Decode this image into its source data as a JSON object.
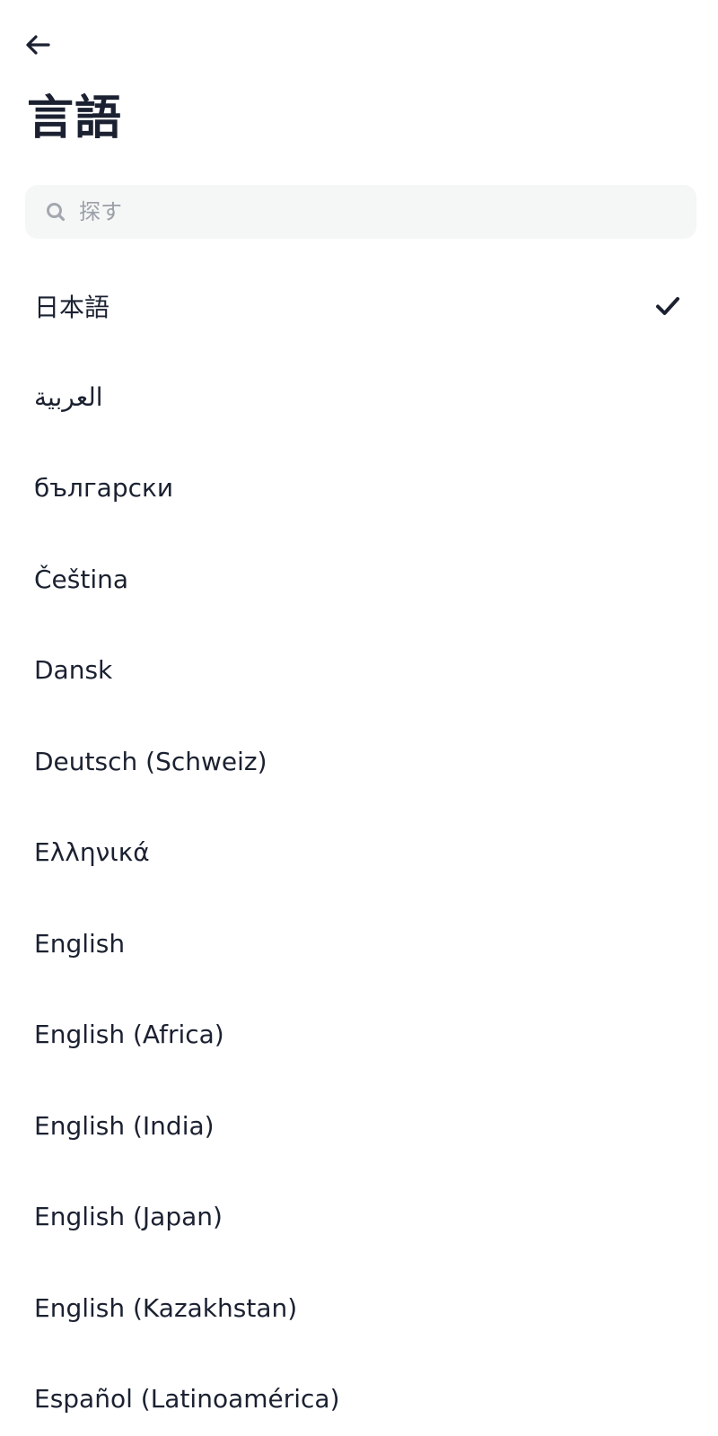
{
  "header": {
    "back_icon": "arrow-left-icon",
    "title": "言語"
  },
  "search": {
    "icon": "search-icon",
    "placeholder": "探す",
    "value": ""
  },
  "languages": [
    {
      "label": "日本語",
      "selected": true
    },
    {
      "label": "العربية",
      "selected": false
    },
    {
      "label": "български",
      "selected": false
    },
    {
      "label": "Čeština",
      "selected": false
    },
    {
      "label": "Dansk",
      "selected": false
    },
    {
      "label": "Deutsch (Schweiz)",
      "selected": false
    },
    {
      "label": "Ελληνικά",
      "selected": false
    },
    {
      "label": "English",
      "selected": false
    },
    {
      "label": "English (Africa)",
      "selected": false
    },
    {
      "label": "English (India)",
      "selected": false
    },
    {
      "label": "English (Japan)",
      "selected": false
    },
    {
      "label": "English (Kazakhstan)",
      "selected": false
    },
    {
      "label": "Español (Latinoamérica)",
      "selected": false
    }
  ],
  "selected_icon": "checkmark-icon",
  "colors": {
    "text": "#1b2131",
    "search_bg": "#f5f6f6",
    "placeholder": "#9aa0a8"
  }
}
